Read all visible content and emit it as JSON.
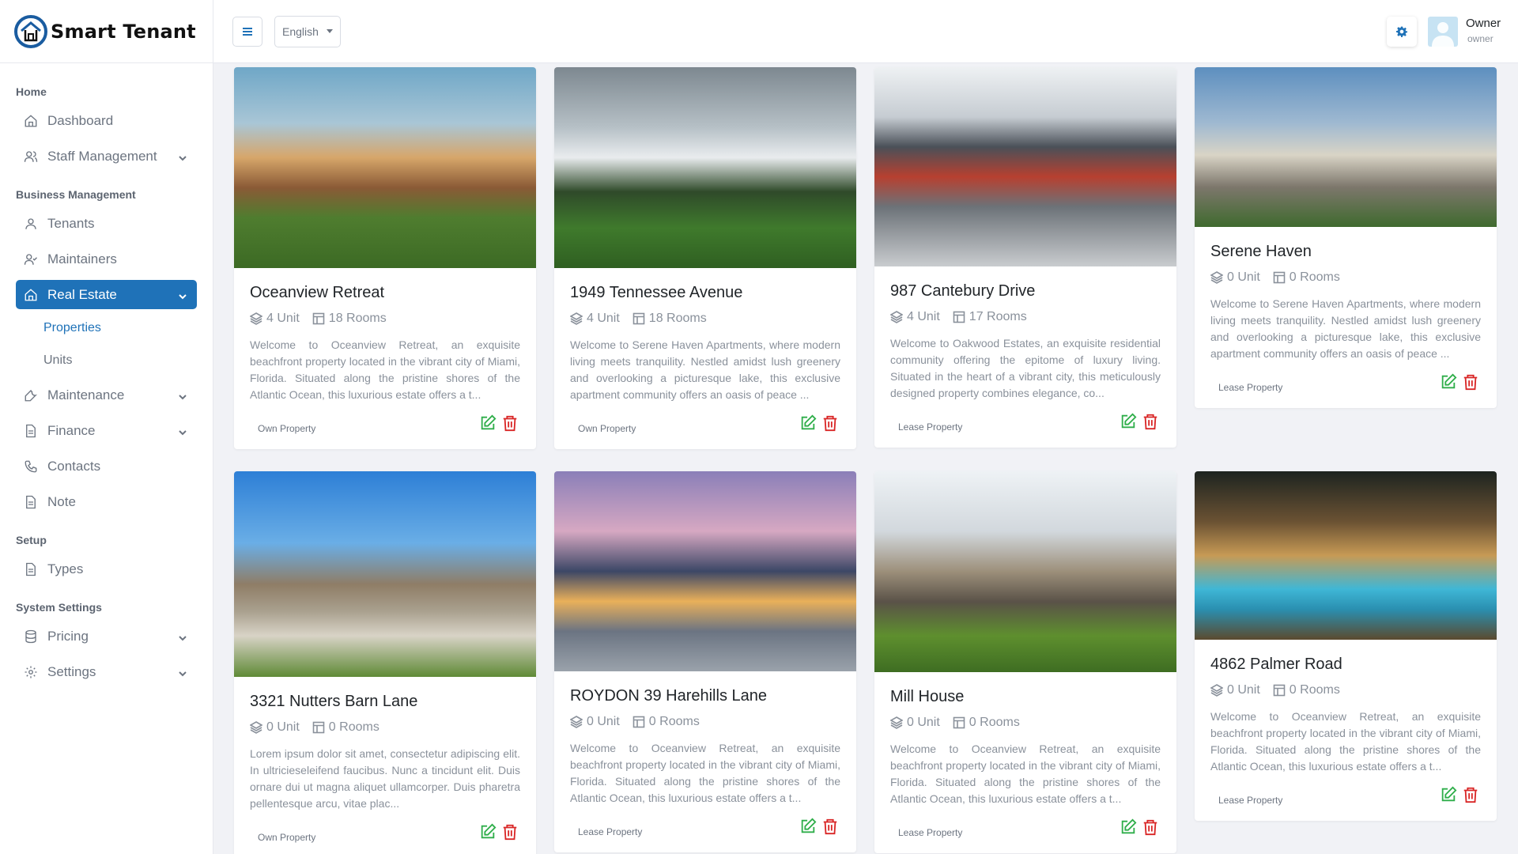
{
  "brand": {
    "name": "Smart Tenant"
  },
  "header": {
    "language": "English",
    "user_name": "Owner",
    "user_role": "owner"
  },
  "sidebar": {
    "sections": {
      "home": "Home",
      "business": "Business Management",
      "setup": "Setup",
      "system": "System Settings"
    },
    "items": {
      "dashboard": "Dashboard",
      "staff": "Staff Management",
      "tenants": "Tenants",
      "maintainers": "Maintainers",
      "real_estate": "Real Estate",
      "properties": "Properties",
      "units": "Units",
      "maintenance": "Maintenance",
      "finance": "Finance",
      "contacts": "Contacts",
      "note": "Note",
      "types": "Types",
      "pricing": "Pricing",
      "settings": "Settings"
    }
  },
  "cards": [
    {
      "title": "Oceanview Retreat",
      "units": "4 Unit",
      "rooms": "18 Rooms",
      "desc": "Welcome to Oceanview Retreat, an exquisite beachfront property located in the vibrant city of Miami, Florida. Situated along the pristine shores of the Atlantic Ocean, this luxurious estate offers a t...",
      "badge": "Own Property"
    },
    {
      "title": "1949 Tennessee Avenue",
      "units": "4 Unit",
      "rooms": "18 Rooms",
      "desc": "Welcome to Serene Haven Apartments, where modern living meets tranquility. Nestled amidst lush greenery and overlooking a picturesque lake, this exclusive apartment community offers an oasis of peace ...",
      "badge": "Own Property"
    },
    {
      "title": "987 Cantebury Drive",
      "units": "4 Unit",
      "rooms": "17 Rooms",
      "desc": "Welcome to Oakwood Estates, an exquisite residential community offering the epitome of luxury living. Situated in the heart of a vibrant city, this meticulously designed property combines elegance, co...",
      "badge": "Lease Property"
    },
    {
      "title": "Serene Haven",
      "units": "0 Unit",
      "rooms": "0 Rooms",
      "desc": "Welcome to Serene Haven Apartments, where modern living meets tranquility. Nestled amidst lush greenery and overlooking a picturesque lake, this exclusive apartment community offers an oasis of peace ...",
      "badge": "Lease Property"
    },
    {
      "title": "3321 Nutters Barn Lane",
      "units": "0 Unit",
      "rooms": "0 Rooms",
      "desc": "Lorem ipsum dolor sit amet, consectetur adipiscing elit. In ultricieseleifend faucibus. Nunc a tincidunt elit. Duis ornare dui ut magna aliquet ullamcorper. Duis pharetra pellentesque arcu, vitae plac...",
      "badge": "Own Property"
    },
    {
      "title": "ROYDON 39 Harehills Lane",
      "units": "0 Unit",
      "rooms": "0 Rooms",
      "desc": "Welcome to Oceanview Retreat, an exquisite beachfront property located in the vibrant city of Miami, Florida. Situated along the pristine shores of the Atlantic Ocean, this luxurious estate offers a t...",
      "badge": "Lease Property"
    },
    {
      "title": "Mill House",
      "units": "0 Unit",
      "rooms": "0 Rooms",
      "desc": "Welcome to Oceanview Retreat, an exquisite beachfront property located in the vibrant city of Miami, Florida. Situated along the pristine shores of the Atlantic Ocean, this luxurious estate offers a t...",
      "badge": "Lease Property"
    },
    {
      "title": "4862 Palmer Road",
      "units": "0 Unit",
      "rooms": "0 Rooms",
      "desc": "Welcome to Oceanview Retreat, an exquisite beachfront property located in the vibrant city of Miami, Florida. Situated along the pristine shores of the Atlantic Ocean, this luxurious estate offers a t...",
      "badge": "Lease Property"
    }
  ],
  "colors": {
    "accent": "#1f72b8",
    "edit": "#2fae4a",
    "delete": "#d92626"
  }
}
